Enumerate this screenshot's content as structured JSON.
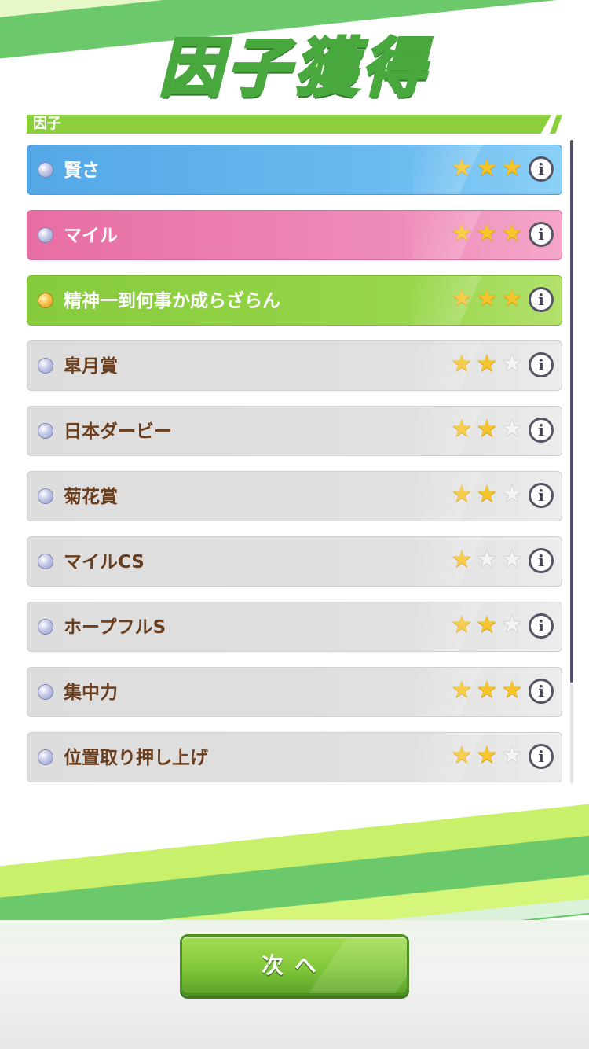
{
  "header": {
    "title": "因子獲得"
  },
  "section": {
    "label": "因子"
  },
  "factors": [
    {
      "name": "賢さ",
      "stars": 3,
      "color": "blue",
      "gem": "silver"
    },
    {
      "name": "マイル",
      "stars": 3,
      "color": "pink",
      "gem": "silver"
    },
    {
      "name": "精神一到何事か成らざらん",
      "stars": 3,
      "color": "green",
      "gem": "gold"
    },
    {
      "name": "皐月賞",
      "stars": 2,
      "color": "gray",
      "gem": "silver"
    },
    {
      "name": "日本ダービー",
      "stars": 2,
      "color": "gray",
      "gem": "silver"
    },
    {
      "name": "菊花賞",
      "stars": 2,
      "color": "gray",
      "gem": "silver"
    },
    {
      "name": "マイルCS",
      "stars": 1,
      "color": "gray",
      "gem": "silver"
    },
    {
      "name": "ホープフルS",
      "stars": 2,
      "color": "gray",
      "gem": "silver"
    },
    {
      "name": "集中力",
      "stars": 3,
      "color": "gray",
      "gem": "silver"
    },
    {
      "name": "位置取り押し上げ",
      "stars": 2,
      "color": "gray",
      "gem": "silver"
    }
  ],
  "max_stars": 3,
  "info_label": "i",
  "next_button": {
    "label": "次へ"
  },
  "colors": {
    "blue": "#53a8e6",
    "pink": "#e76ea3",
    "green": "#86cc3c",
    "gray": "#dddddd",
    "accent": "#6cc96b"
  }
}
